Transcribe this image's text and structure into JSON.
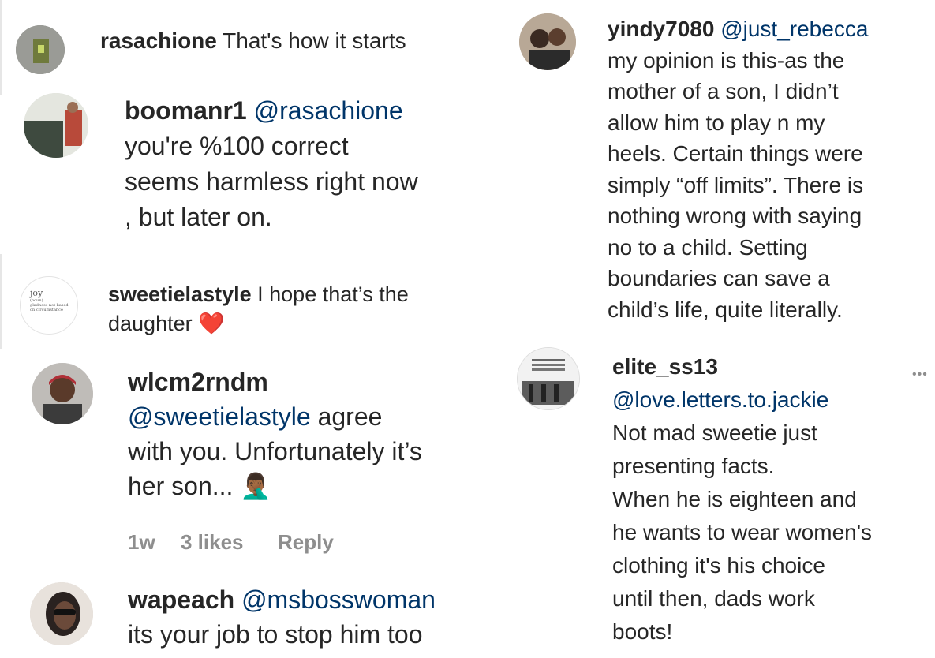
{
  "colors": {
    "mention": "#003569",
    "text": "#262626",
    "meta": "#8e8e8e",
    "heart": "#ed1c24"
  },
  "comments": [
    {
      "username": "rasachione",
      "mention": "",
      "text": "That's how it starts"
    },
    {
      "username": "boomanr1",
      "mention": "@rasachione",
      "text": "you're %100 correct\nseems harmless right now\n, but later on."
    },
    {
      "username": "sweetielastyle",
      "mention": "",
      "text": "I hope that’s the\ndaughter",
      "emoji": "❤️",
      "avatar_text": {
        "title": "joy",
        "sub": "(noun)",
        "line1": "gladness not based",
        "line2": "on circumstance"
      }
    },
    {
      "username": "wlcm2rndm",
      "mention": "@sweetielastyle",
      "text": "agree\nwith you. Unfortunately it’s\nher son...",
      "emoji": "🤦🏾‍♂️",
      "time": "1w",
      "likes": "3 likes",
      "reply": "Reply"
    },
    {
      "username": "wapeach",
      "mention": "@msbosswoman",
      "text": "its your job to stop him too"
    },
    {
      "username": "yindy7080",
      "mention": "@just_rebecca",
      "text": "my opinion is this-as the\nmother of a son, I didn’t\nallow him to play n my\nheels. Certain things were\nsimply “off limits”. There is\nnothing wrong with saying\nno to a child. Setting\nboundaries can save a\nchild’s life, quite literally."
    },
    {
      "username": "elite_ss13",
      "mention": "@love.letters.to.jackie",
      "text": "Not mad sweetie just\npresenting facts.\nWhen he is eighteen and\nhe wants to wear women's\nclothing it's his choice\nuntil then, dads work\nboots!",
      "more": "•••"
    }
  ]
}
